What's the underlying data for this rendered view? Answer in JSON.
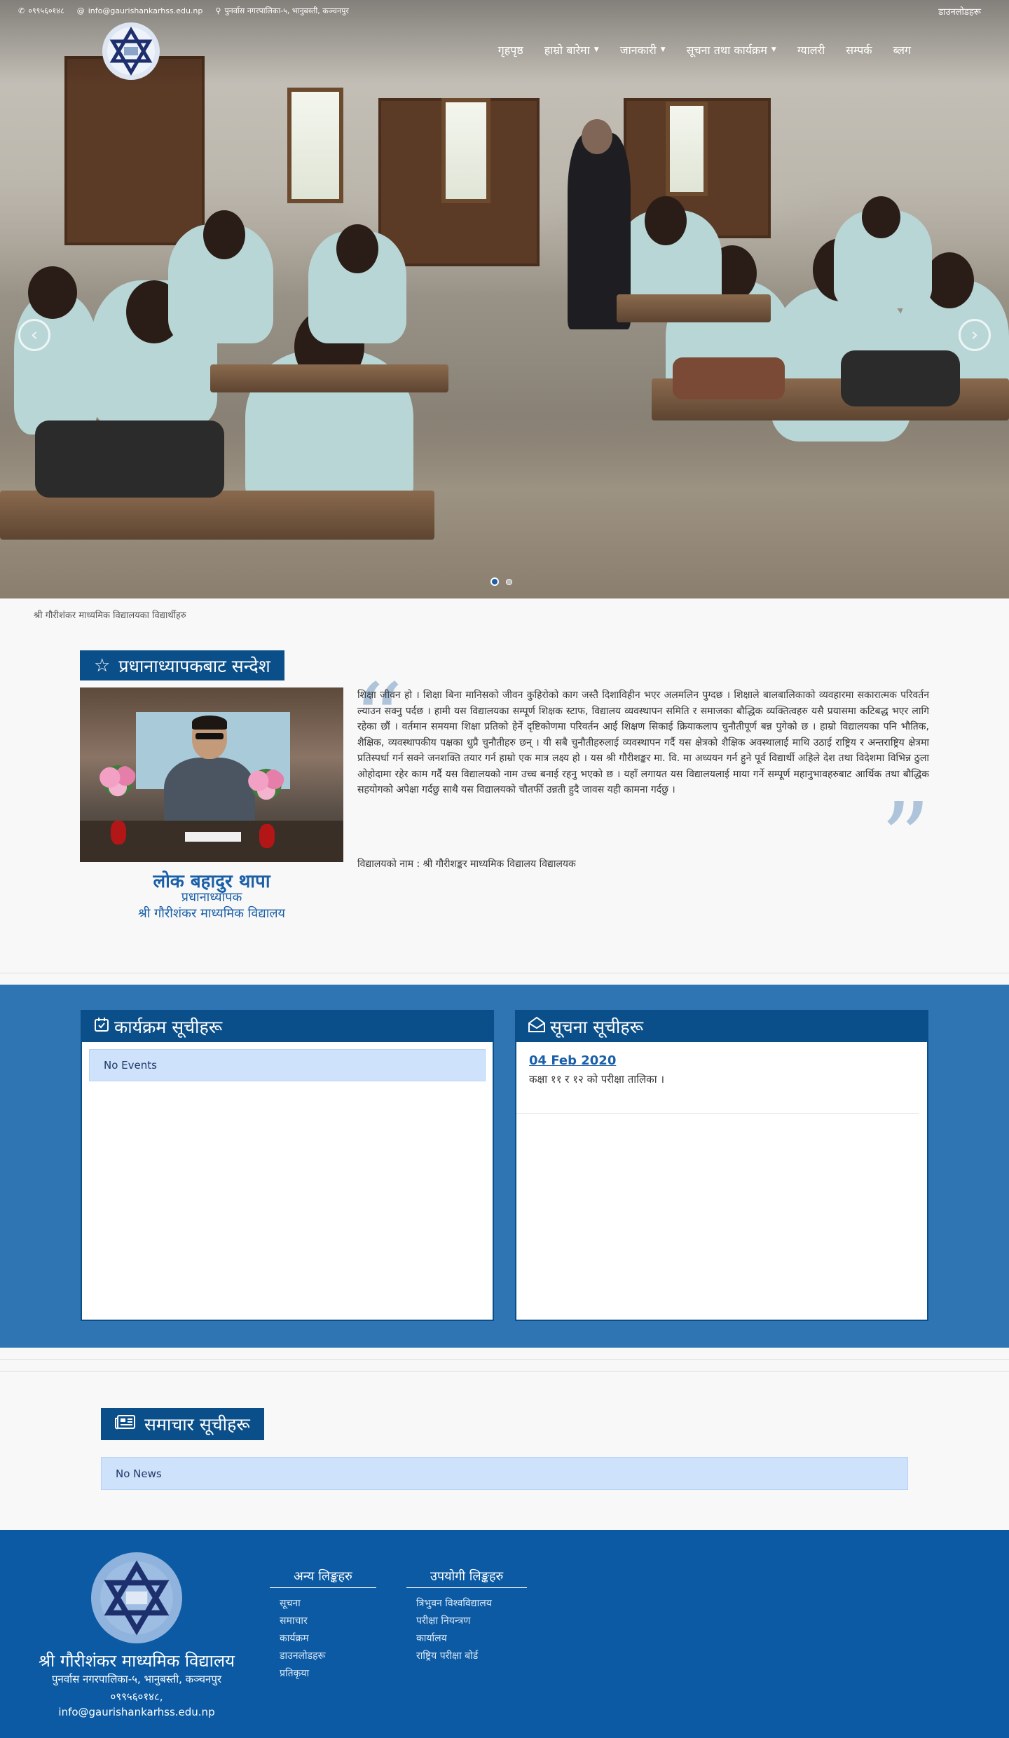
{
  "topbar": {
    "phone": "०९९५६०१४८",
    "email": "info@gaurishankarhss.edu.np",
    "address": "पुनर्वास नगरपालिका-५, भानुबस्ती, कञ्चनपुर",
    "downloads": "डाउनलोडहरू",
    "icons": {
      "phone": "phone-icon",
      "email": "at-icon",
      "address": "map-pin-icon"
    }
  },
  "nav": {
    "items": [
      {
        "label": "गृहपृष्ठ",
        "dropdown": false
      },
      {
        "label": "हाम्रो बारेमा",
        "dropdown": true
      },
      {
        "label": "जानकारी",
        "dropdown": true
      },
      {
        "label": "सूचना तथा कार्यक्रम",
        "dropdown": true
      },
      {
        "label": "ग्यालरी",
        "dropdown": false
      },
      {
        "label": "सम्पर्क",
        "dropdown": false
      },
      {
        "label": "ब्लग",
        "dropdown": false
      }
    ]
  },
  "carousel": {
    "caption": "श्री गौरीशंकर माध्यमिक विद्यालयका विद्यार्थीहरु",
    "prev": "‹",
    "next": "›",
    "slide_count": 2,
    "active_slide": 1
  },
  "principal": {
    "heading": "प्रधानाध्यापकबाट सन्देश",
    "name": "लोक बहादुर थापा",
    "role": "प्रधानाध्यापक",
    "school": "श्री गौरीशंकर माध्यमिक विद्यालय",
    "message": "शिक्षा जीवन हो । शिक्षा बिना मानिसको जीवन कुहिरोको काग जस्तै दिशाविहीन भएर अलमलिन पुग्दछ । शिक्षाले बालबालिकाको व्यवहारमा सकारात्मक परिवर्तन ल्याउन सक्नु पर्दछ । हामी यस विद्यालयका सम्पूर्ण शिक्षक स्टाफ, विद्यालय व्यवस्थापन समिति र समाजका बौद्धिक व्यक्तित्वहरु यसै प्रयासमा कटिबद्ध भएर लागि रहेका छौं । वर्तमान समयमा शिक्षा प्रतिको हेर्ने दृष्टिकोणमा परिवर्तन आई शिक्षण सिकाई क्रियाकलाप चुनौतीपूर्ण बन्न पुगेको छ । हाम्रो विद्यालयका पनि भौतिक, शैक्षिक, व्यवस्थापकीय पक्षका धुप्रै चुनौतीहरु छन् । यी सबै चुनौतीहरुलाई व्यवस्थापन गर्दै यस क्षेत्रको शैक्षिक अवस्थालाई माथि उठाई राष्ट्रिय र अन्तराष्ट्रिय क्षेत्रमा प्रतिस्पर्धा गर्न सक्ने जनशक्ति तयार गर्न हाम्रो एक मात्र लक्ष्य हो । यस श्री गौरीशङ्कर मा. वि. मा अध्ययन गर्न हुने पूर्व विद्यार्थी अहिले देश तथा विदेशमा विभिन्न ठुला ओहोदामा रहेर काम गर्दै यस विद्यालयको नाम उच्च बनाई रहनु भएको छ । यहाँ लगायत यस विद्यालयलाई माया गर्ने सम्पूर्ण महानुभावहरुबाट आर्थिक तथा बौद्धिक सहयोगको अपेक्षा गर्दछु साथै यस विद्यालयको चौतर्फी उन्नती हुदै जावस यही कामना गर्दछु ।",
    "school_line": "विद्यालयको नाम : श्री गौरीशङ्कर माध्यमिक विद्यालय विद्यालयक"
  },
  "events": {
    "heading": "कार्यक्रम सूचीहरू",
    "empty_text": "No Events",
    "icon": "calendar-check-icon"
  },
  "notices": {
    "heading": "सूचना सूचीहरू",
    "icon": "envelope-open-icon",
    "items": [
      {
        "date": "04 Feb 2020",
        "title": "कक्षा ११ र १२ को परीक्षा तालिका ।"
      }
    ]
  },
  "news": {
    "heading": "समाचार सूचीहरू",
    "icon": "newspaper-icon",
    "empty_text": "No News"
  },
  "footer": {
    "school_name": "श्री गौरीशंकर माध्यमिक विद्यालय",
    "address": "पुनर्वास नगरपालिका-५, भानुबस्ती, कञ्चनपुर",
    "phone": "०९९५६०१४८,",
    "email": "info@gaurishankarhss.edu.np",
    "other_links": {
      "heading": "अन्य लिङ्कहरु",
      "items": [
        "सूचना",
        "समाचार",
        "कार्यक्रम",
        "डाउनलोडहरू",
        "प्रतिकृया"
      ]
    },
    "useful_links": {
      "heading": "उपयोगी लिङ्कहरु",
      "items": [
        "त्रिभुवन विश्वविद्यालय",
        "परीक्षा नियन्त्रण",
        "कार्यालय",
        "राष्ट्रिय परीक्षा बोर्ड"
      ]
    }
  },
  "colors": {
    "primary": "#0b4f8a",
    "band": "#2f75b3",
    "footer": "#0b5aa3",
    "alert_bg": "#cfe2fb",
    "link": "#1a5fa8"
  }
}
